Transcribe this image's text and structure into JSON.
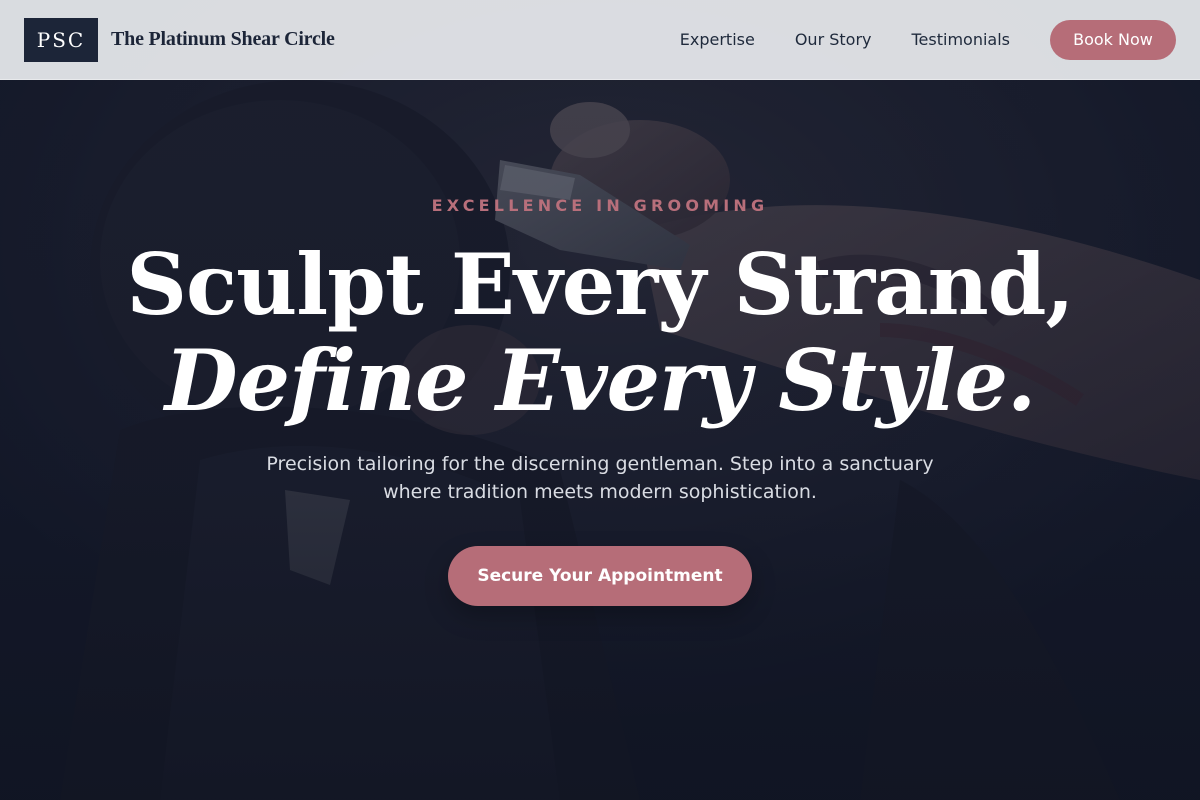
{
  "header": {
    "logo_text": "PSC",
    "brand_name": "The Platinum Shear Circle",
    "nav": [
      {
        "label": "Expertise"
      },
      {
        "label": "Our Story"
      },
      {
        "label": "Testimonials"
      }
    ],
    "book_label": "Book Now"
  },
  "hero": {
    "eyebrow": "EXCELLENCE IN GROOMING",
    "headline_line1": "Sculpt Every Strand,",
    "headline_line2": "Define Every Style.",
    "subtitle": "Precision tailoring for the discerning gentleman. Step into a sanctuary where tradition meets modern sophistication.",
    "cta_label": "Secure Your Appointment",
    "background_icon": "barber-clipper-photo"
  },
  "colors": {
    "accent": "#b66d78",
    "navy": "#1c2538",
    "hero_bg": "#141a2b",
    "header_bg": "#e2e4e8"
  }
}
